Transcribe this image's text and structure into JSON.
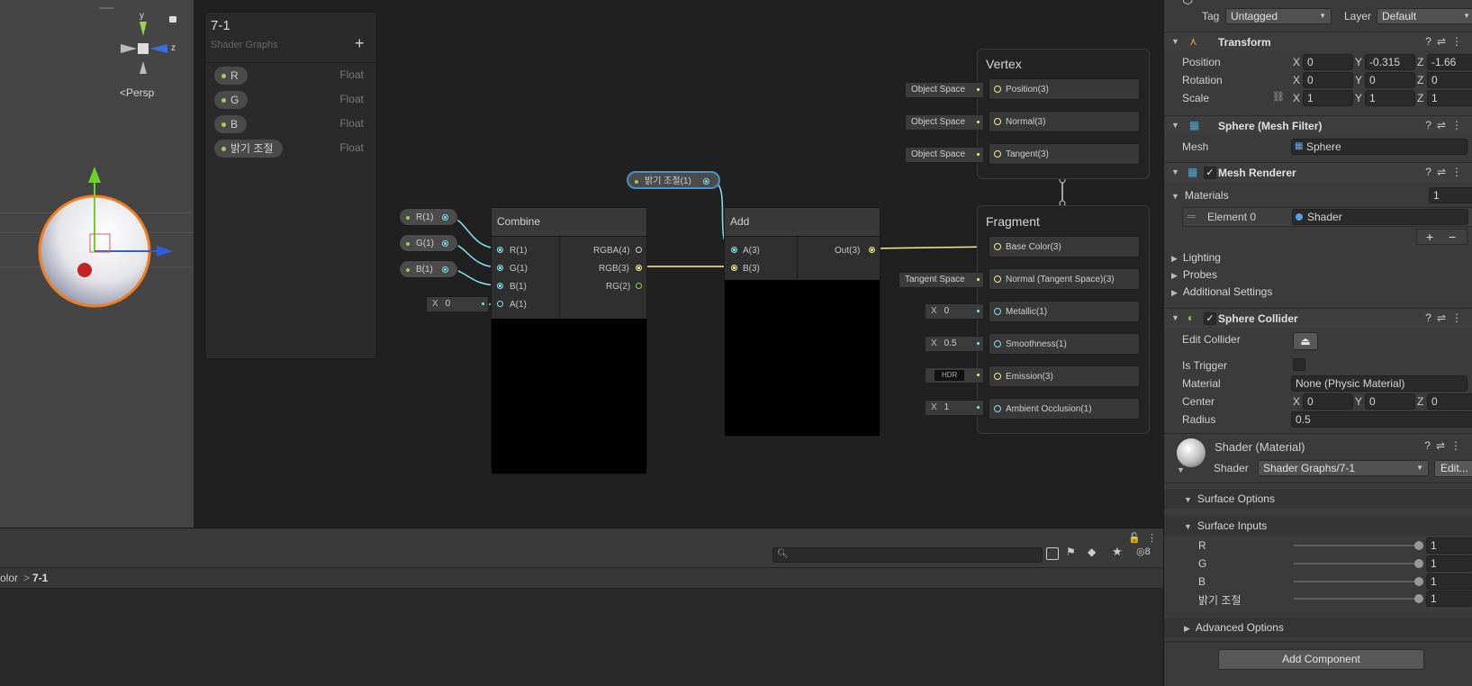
{
  "scene": {
    "gizmo_y_label": "y",
    "gizmo_z_label": "z",
    "persp_label": "<Persp"
  },
  "blackboard": {
    "title": "7-1",
    "subtitle": "Shader Graphs",
    "add_label": "+",
    "properties": [
      {
        "name": "R",
        "type": "Float"
      },
      {
        "name": "G",
        "type": "Float"
      },
      {
        "name": "B",
        "type": "Float"
      },
      {
        "name": "밝기 조절",
        "type": "Float"
      }
    ]
  },
  "graph": {
    "property_pills": [
      "R(1)",
      "G(1)",
      "B(1)",
      "밝기 조절(1)"
    ],
    "combine": {
      "title": "Combine",
      "inputs": [
        "R(1)",
        "G(1)",
        "B(1)",
        "A(1)"
      ],
      "outputs": [
        "RGBA(4)",
        "RGB(3)",
        "RG(2)"
      ],
      "a_field_axis": "X",
      "a_field_value": "0"
    },
    "add": {
      "title": "Add",
      "inputs": [
        "A(3)",
        "B(3)"
      ],
      "outputs": [
        "Out(3)"
      ]
    },
    "vertex": {
      "title": "Vertex",
      "blocks": [
        {
          "label": "Position(3)",
          "field": "Object Space"
        },
        {
          "label": "Normal(3)",
          "field": "Object Space"
        },
        {
          "label": "Tangent(3)",
          "field": "Object Space"
        }
      ]
    },
    "fragment": {
      "title": "Fragment",
      "blocks": [
        {
          "label": "Base Color(3)",
          "field": ""
        },
        {
          "label": "Normal (Tangent Space)(3)",
          "field": "Tangent Space"
        },
        {
          "label": "Metallic(1)",
          "field": "0",
          "axis": "X"
        },
        {
          "label": "Smoothness(1)",
          "field": "0.5",
          "axis": "X"
        },
        {
          "label": "Emission(3)",
          "field": "HDR"
        },
        {
          "label": "Ambient Occlusion(1)",
          "field": "1",
          "axis": "X"
        }
      ]
    }
  },
  "bottom": {
    "search_placeholder": "",
    "breadcrumb_parent": "olor",
    "breadcrumb_sep": ">",
    "breadcrumb_current": "7-1",
    "hidden_count": "8"
  },
  "inspector": {
    "tag_label": "Tag",
    "tag_value": "Untagged",
    "layer_label": "Layer",
    "layer_value": "Default",
    "transform": {
      "title": "Transform",
      "position_label": "Position",
      "rotation_label": "Rotation",
      "scale_label": "Scale",
      "position": {
        "x": "0",
        "y": "-0.315",
        "z": "-1.66"
      },
      "rotation": {
        "x": "0",
        "y": "0",
        "z": "0"
      },
      "scale": {
        "x": "1",
        "y": "1",
        "z": "1"
      },
      "x_axis": "X",
      "y_axis": "Y",
      "z_axis": "Z"
    },
    "mesh_filter": {
      "title": "Sphere (Mesh Filter)",
      "mesh_label": "Mesh",
      "mesh_value": "Sphere"
    },
    "mesh_renderer": {
      "title": "Mesh Renderer",
      "materials_label": "Materials",
      "materials_count": "1",
      "element_label": "Element 0",
      "element_value": "Shader",
      "add_label": "+",
      "remove_label": "−",
      "lighting_label": "Lighting",
      "probes_label": "Probes",
      "additional_label": "Additional Settings"
    },
    "sphere_collider": {
      "title": "Sphere Collider",
      "edit_collider_label": "Edit Collider",
      "is_trigger_label": "Is Trigger",
      "material_label": "Material",
      "material_value": "None (Physic Material)",
      "center_label": "Center",
      "center": {
        "x": "0",
        "y": "0",
        "z": "0"
      },
      "radius_label": "Radius",
      "radius_value": "0.5"
    },
    "material": {
      "title": "Shader (Material)",
      "shader_label": "Shader",
      "shader_value": "Shader Graphs/7-1",
      "edit_label": "Edit...",
      "surface_options_label": "Surface Options",
      "surface_inputs_label": "Surface Inputs",
      "inputs": [
        {
          "name": "R",
          "value": "1"
        },
        {
          "name": "G",
          "value": "1"
        },
        {
          "name": "B",
          "value": "1"
        },
        {
          "name": "밝기 조절",
          "value": "1"
        }
      ],
      "advanced_label": "Advanced Options"
    },
    "add_component_label": "Add Component"
  },
  "colors": {
    "vector3_wire": "#f0ef93",
    "float_wire": "#84e4e7",
    "bool_dot": "#9ccf54",
    "selection": "#4a8fc8"
  }
}
